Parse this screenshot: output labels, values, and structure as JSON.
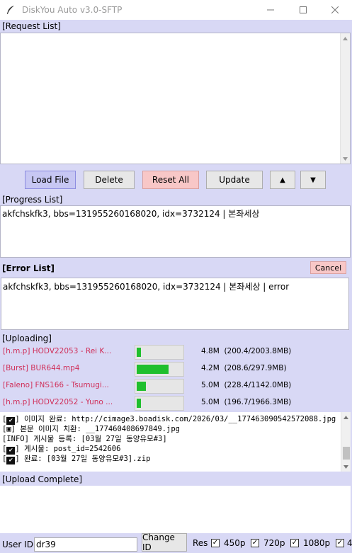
{
  "window": {
    "title": "DiskYou Auto v3.0-SFTP",
    "min_icon": "minimize-icon",
    "max_icon": "maximize-icon",
    "close_icon": "close-icon"
  },
  "request_list": {
    "label": "[Request List]"
  },
  "toolbar": {
    "load_label": "Load File",
    "delete_label": "Delete",
    "reset_label": "Reset All",
    "update_label": "Update",
    "up_glyph": "▲",
    "down_glyph": "▼"
  },
  "progress_list": {
    "label": "[Progress List]",
    "items": [
      "akfchskfk3, bbs=131955260168020, idx=3732124 | 본좌세상"
    ]
  },
  "error_list": {
    "label": "[Error List]",
    "cancel_label": "Cancel",
    "items": [
      "akfchskfk3, bbs=131955260168020, idx=3732124 | 본좌세상 | error"
    ]
  },
  "uploading": {
    "label": "[Uploading]",
    "rows": [
      {
        "name": "[h.m.p] HODV22053 - Rei K...",
        "progress": 0.1,
        "speed": "4.8M",
        "size": "(200.4/2003.8MB)"
      },
      {
        "name": "[Burst] BUR644.mp4",
        "progress": 0.7,
        "speed": "4.2M",
        "size": "(208.6/297.9MB)"
      },
      {
        "name": "[Faleno] FNS166 - Tsumugi...",
        "progress": 0.2,
        "speed": "5.0M",
        "size": "(228.4/1142.0MB)"
      },
      {
        "name": "[h.m.p] HODV22052 - Yuno ...",
        "progress": 0.1,
        "speed": "5.0M",
        "size": "(196.7/1966.3MB)"
      }
    ]
  },
  "log": {
    "lines": [
      {
        "prefix": "[",
        "mark": "✔",
        "suffix": "] 이미지 완료: http://cimage3.boadisk.com/2026/03/__177463090542572088.jpg"
      },
      {
        "prefix": "[",
        "mark": "▣",
        "suffix": "] 본문 이미지 치환: __177460408697849.jpg"
      },
      {
        "prefix": "",
        "mark": "",
        "suffix": "[INFO] 게시물 등록: [03월 27일 동양유모#3]"
      },
      {
        "prefix": "[",
        "mark": "✔",
        "suffix": "] 게시물: post_id=2542606"
      },
      {
        "prefix": "[",
        "mark": "✔",
        "suffix": "] 완료: [03월 27일 동양유모#3].zip"
      }
    ]
  },
  "upload_complete": {
    "label": "[Upload Complete]"
  },
  "bottom": {
    "user_id_label": "User ID",
    "user_id_value": "dr39",
    "change_id_label": "Change ID",
    "res_label": "Res",
    "res_options": [
      "450p",
      "720p",
      "1080p",
      "4"
    ]
  },
  "colors": {
    "lavender": "#d8d8f5",
    "progress_fill": "#1fbf2d",
    "upload_name": "#d0305a"
  }
}
